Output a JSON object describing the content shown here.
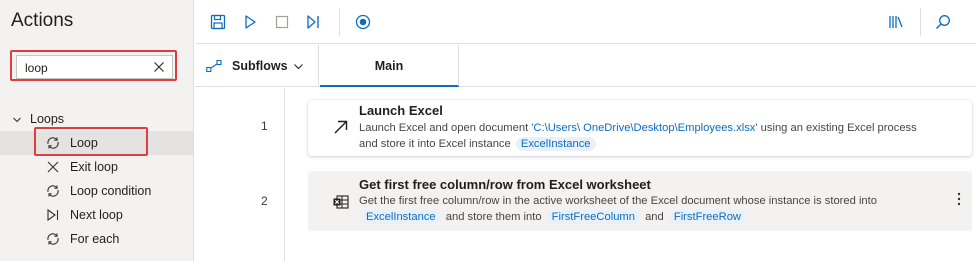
{
  "actions_pane": {
    "title": "Actions",
    "search": {
      "value": "loop",
      "placeholder": ""
    },
    "group": {
      "label": "Loops"
    },
    "items": [
      {
        "label": "Loop",
        "icon": "loop-icon",
        "selected": true
      },
      {
        "label": "Exit loop",
        "icon": "close-icon",
        "selected": false
      },
      {
        "label": "Loop condition",
        "icon": "loop-icon",
        "selected": false
      },
      {
        "label": "Next loop",
        "icon": "next-loop-icon",
        "selected": false
      },
      {
        "label": "For each",
        "icon": "loop-icon",
        "selected": false
      }
    ]
  },
  "toolbar": {
    "buttons": [
      "save-icon",
      "run-icon",
      "stop-icon",
      "run-next-action-icon",
      "record-icon",
      "variables-icon",
      "search-icon"
    ]
  },
  "tabs": {
    "subflows_label": "Subflows",
    "main_label": "Main"
  },
  "flow": {
    "steps": [
      {
        "number": "1",
        "title": "Launch Excel",
        "desc_prefix": "Launch Excel and open document ",
        "path": "'C:\\Users\\          OneDrive\\Desktop\\Employees.xlsx'",
        "desc_mid": " using an existing Excel process and store it into Excel instance ",
        "token1": "ExcelInstance"
      },
      {
        "number": "2",
        "title": "Get first free column/row from Excel worksheet",
        "desc_prefix": "Get the first free column/row in the active worksheet of the Excel document whose instance is stored into ",
        "token1": "ExcelInstance",
        "desc_mid": " and store them into ",
        "token2": "FirstFreeColumn",
        "desc_and": " and ",
        "token3": "FirstFreeRow"
      }
    ]
  },
  "colors": {
    "accent": "#0f6cbd",
    "highlight_box": "#e03e3e",
    "pane_bg": "#f3f2f1"
  }
}
